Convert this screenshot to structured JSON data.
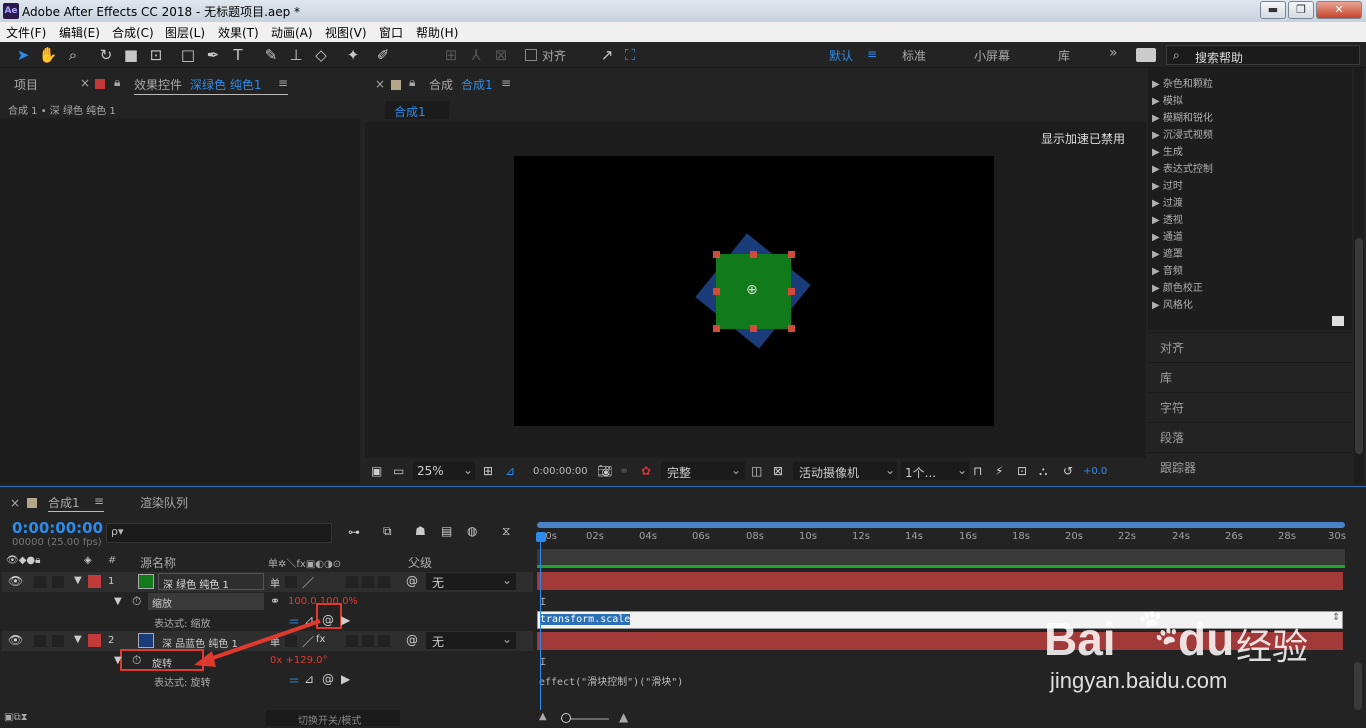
{
  "window": {
    "app_icon": "Ae",
    "title": "Adobe After Effects CC 2018 - 无标题项目.aep *",
    "minimize": "▬",
    "restore": "❐",
    "close": "✕"
  },
  "menu": [
    "文件(F)",
    "编辑(E)",
    "合成(C)",
    "图层(L)",
    "效果(T)",
    "动画(A)",
    "视图(V)",
    "窗口",
    "帮助(H)"
  ],
  "toolbar": {
    "align_label": "对齐",
    "workspaces": [
      "默认",
      "标准",
      "小屏幕",
      "库"
    ],
    "workspace_menu": "≡",
    "more": "»",
    "search_placeholder": "搜索帮助"
  },
  "project_panel": {
    "tab_project": "项目",
    "tab_effects_prefix": "效果控件",
    "tab_effects_layer": "深绿色 纯色1",
    "breadcrumb": "合成 1 • 深 绿色 纯色 1"
  },
  "comp_panel": {
    "tab_prefix": "合成",
    "tab_name": "合成1",
    "sub_tab": "合成1",
    "notice": "显示加速已禁用"
  },
  "comp_footer": {
    "zoom": "25%",
    "timecode": "0:00:00:00",
    "resolution": "完整",
    "camera": "活动摄像机",
    "views": "1个...",
    "exposure": "+0.0"
  },
  "effects_list": [
    "杂色和颗粒",
    "模拟",
    "模糊和锐化",
    "沉浸式视频",
    "生成",
    "表达式控制",
    "过时",
    "过渡",
    "透视",
    "通道",
    "遮罩",
    "音频",
    "颜色校正",
    "风格化"
  ],
  "side_panels": [
    "对齐",
    "库",
    "字符",
    "段落",
    "跟踪器"
  ],
  "timeline": {
    "tab_comp": "合成1",
    "tab_render": "渲染队列",
    "timecode": "0:00:00:00",
    "frames": "00000 (25.00 fps)",
    "search_icon_text": "ρ▾",
    "col_num": "#",
    "col_source": "源名称",
    "col_parent": "父级",
    "layers": [
      {
        "num": "1",
        "name": "深 绿色 纯色 1",
        "swatch": "#1a7a1a",
        "parent": "无"
      },
      {
        "num": "2",
        "name": "深 品蓝色 纯色 1",
        "swatch": "#1c3f7a",
        "parent": "无"
      }
    ],
    "scale_label": "缩放",
    "scale_value": "100.0,100.0%",
    "expr_scale_label": "表达式: 缩放",
    "rotate_label": "旋转",
    "rotate_value": "0x +129.0°",
    "expr_rotate_label": "表达式: 旋转",
    "toggle_label": "切换开关/模式",
    "ruler": [
      "00s",
      "02s",
      "04s",
      "06s",
      "08s",
      "10s",
      "12s",
      "14s",
      "16s",
      "18s",
      "20s",
      "22s",
      "24s",
      "26s",
      "28s",
      "30s"
    ],
    "expr_scale_text": "transform.scale",
    "expr_rotate_text": "effect(\"滑块控制\")(\"滑块\")"
  },
  "watermark": {
    "brand": "Bai",
    "brand2": "du",
    "brand3": "经验",
    "url": "jingyan.baidu.com"
  },
  "colors": {
    "accent": "#2d8ceb",
    "layer_bar": "#a23a3a",
    "expr_red": "#e03a2e",
    "green_solid": "#117a1a",
    "blue_solid": "#1a3d7a"
  }
}
